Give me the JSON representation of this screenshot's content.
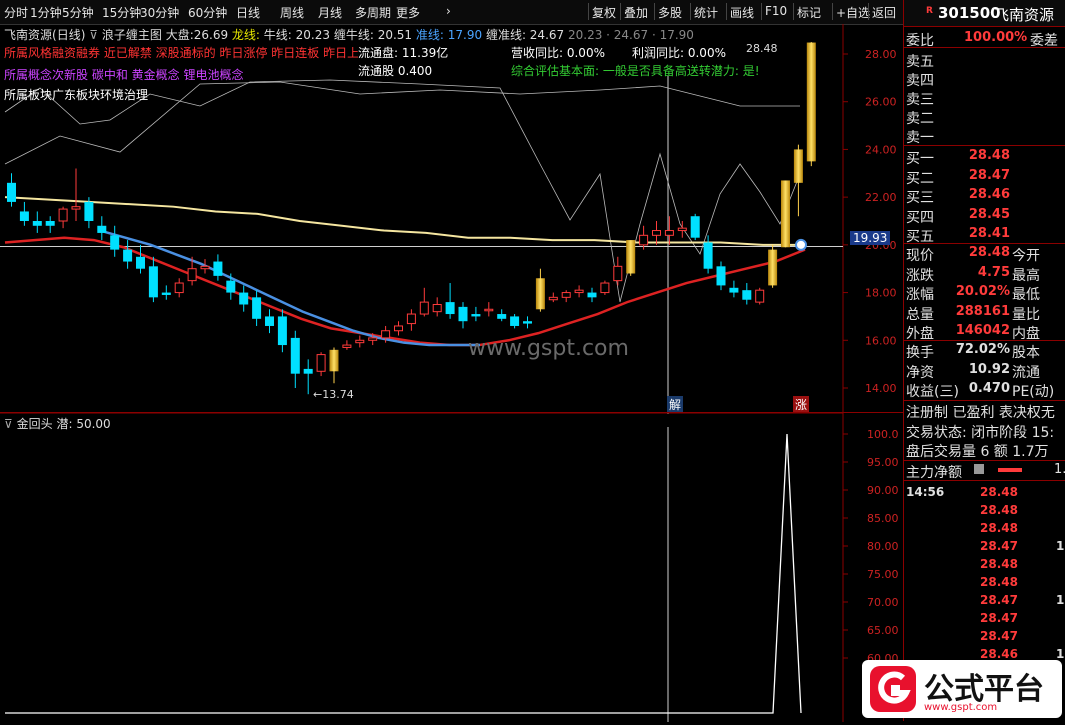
{
  "toolbar": {
    "left_items": [
      "分时",
      "1分钟",
      "5分钟",
      "15分钟",
      "30分钟",
      "60分钟",
      "日线",
      "周线",
      "月线",
      "多周期",
      "更多"
    ],
    "right_items": [
      "复权",
      "叠加",
      "多股",
      "统计",
      "画线",
      "F10",
      "标记",
      "+自选",
      "返回"
    ]
  },
  "header": {
    "stock": "飞南资源",
    "period": "(日线)",
    "indicator": "浪子缠主图",
    "dapan_label": "大盘:",
    "dapan_value": "26.69",
    "longxian_label": "龙线:",
    "niuxian": "牛线: 20.23",
    "channiu": "缠牛线: 20.51",
    "zhunxian": "准线: 17.90",
    "chanzhun": "缠准线: 24.67",
    "extra": "20.23 · 24.67 · 17.90",
    "risk_text": "所属风格融资融券 近已解禁 深股通标的 昨日涨停 昨日连板 昨日上榜",
    "circ_label": "流通盘: 11.39亿",
    "revenue_label": "营收同比: 0.00%",
    "profit_label": "利润同比: 0.00%",
    "concept_text": "所属概念次新股 碳中和 黄金概念 锂电池概念",
    "circ_shares": "流通股  0.400",
    "eval_text": "综合评估基本面: 一般是否具备高送转潜力: 是!",
    "board_text": "所属板块广东板块环境治理",
    "last_price_label": "28.48",
    "low_label": "←13.74",
    "cross_price": "19.93",
    "marker_jie": "解",
    "marker_zhang": "涨"
  },
  "sub": {
    "title": "金回头",
    "param": "潜: 50.00",
    "yticks": [
      "100.0",
      "95.00",
      "90.00",
      "85.00",
      "80.00",
      "75.00",
      "70.00",
      "65.00",
      "60.00"
    ]
  },
  "main_yticks": [
    "28.00",
    "26.00",
    "24.00",
    "22.00",
    "20.00",
    "18.00",
    "16.00",
    "14.00"
  ],
  "watermark": "www.gspt.com",
  "panel": {
    "badge": "R",
    "code": "301500",
    "name": "飞南资源",
    "weibi_label": "委比",
    "weibi_value": "100.00%",
    "weicha_label": "委差",
    "sells": [
      "卖五",
      "卖四",
      "卖三",
      "卖二",
      "卖一"
    ],
    "buys": [
      {
        "label": "买一",
        "price": "28.48"
      },
      {
        "label": "买二",
        "price": "28.47"
      },
      {
        "label": "买三",
        "price": "28.46"
      },
      {
        "label": "买四",
        "price": "28.45"
      },
      {
        "label": "买五",
        "price": "28.41"
      }
    ],
    "quotes": [
      {
        "label": "现价",
        "value": "28.48",
        "extra": "今开"
      },
      {
        "label": "涨跌",
        "value": "4.75",
        "extra": "最高"
      },
      {
        "label": "涨幅",
        "value": "20.02%",
        "extra": "最低"
      },
      {
        "label": "总量",
        "value": "288161",
        "extra": "量比"
      },
      {
        "label": "外盘",
        "value": "146042",
        "extra": "内盘"
      }
    ],
    "fundamentals": [
      {
        "label": "换手",
        "value": "72.02%",
        "extra": "股本"
      },
      {
        "label": "净资",
        "value": "10.92",
        "extra": "流通"
      },
      {
        "label": "收益(三)",
        "value": "0.470",
        "extra": "PE(动)"
      }
    ],
    "reg_text": "注册制 已盈利 表决权无",
    "trade_status": "交易状态: 闭市阶段 15:",
    "after_hours": "盘后交易量 6 额 1.7万",
    "main_net": "主力净额",
    "main_net_val": "1.",
    "ticks_time": "14:56",
    "ticks": [
      "28.48",
      "28.48",
      "28.48",
      "28.47",
      "28.48",
      "28.48",
      "28.47",
      "28.47",
      "28.47",
      "28.46"
    ],
    "tick_vols": [
      "",
      "",
      "",
      "1",
      "",
      "",
      "1",
      "",
      "",
      "1"
    ]
  },
  "logo": {
    "text": "公式平台",
    "sub": "www.gspt.com"
  },
  "chart_data": {
    "type": "candlestick",
    "ylim": [
      13,
      29
    ],
    "candles": [
      {
        "o": 22.6,
        "h": 23.0,
        "c": 21.8,
        "l": 21.6
      },
      {
        "o": 21.4,
        "h": 21.8,
        "c": 21.0,
        "l": 20.8
      },
      {
        "o": 21.0,
        "h": 21.4,
        "c": 20.8,
        "l": 20.5
      },
      {
        "o": 21.0,
        "h": 21.2,
        "c": 20.8,
        "l": 20.5
      },
      {
        "o": 21.0,
        "h": 21.6,
        "c": 21.5,
        "l": 20.7
      },
      {
        "o": 21.5,
        "h": 23.2,
        "c": 21.6,
        "l": 21.0
      },
      {
        "o": 21.8,
        "h": 22.0,
        "c": 21.0,
        "l": 20.7
      },
      {
        "o": 20.8,
        "h": 21.2,
        "c": 20.5,
        "l": 20.2
      },
      {
        "o": 20.4,
        "h": 20.8,
        "c": 19.8,
        "l": 19.5
      },
      {
        "o": 19.8,
        "h": 20.2,
        "c": 19.3,
        "l": 19.0
      },
      {
        "o": 19.5,
        "h": 20.0,
        "c": 19.0,
        "l": 18.8
      },
      {
        "o": 19.1,
        "h": 19.5,
        "c": 17.8,
        "l": 17.6
      },
      {
        "o": 18.0,
        "h": 18.3,
        "c": 17.9,
        "l": 17.7
      },
      {
        "o": 18.0,
        "h": 18.6,
        "c": 18.4,
        "l": 17.8
      },
      {
        "o": 18.5,
        "h": 19.5,
        "c": 19.0,
        "l": 18.3
      },
      {
        "o": 19.0,
        "h": 19.4,
        "c": 19.1,
        "l": 18.8
      },
      {
        "o": 19.3,
        "h": 19.6,
        "c": 18.7,
        "l": 18.5
      },
      {
        "o": 18.5,
        "h": 18.8,
        "c": 18.0,
        "l": 17.7
      },
      {
        "o": 18.0,
        "h": 18.3,
        "c": 17.5,
        "l": 17.2
      },
      {
        "o": 17.8,
        "h": 18.1,
        "c": 16.9,
        "l": 16.6
      },
      {
        "o": 17.0,
        "h": 17.3,
        "c": 16.6,
        "l": 16.3
      },
      {
        "o": 17.0,
        "h": 17.3,
        "c": 15.8,
        "l": 15.5
      },
      {
        "o": 16.1,
        "h": 16.4,
        "c": 14.6,
        "l": 14.0
      },
      {
        "o": 14.8,
        "h": 15.2,
        "c": 14.6,
        "l": 13.74
      },
      {
        "o": 14.7,
        "h": 15.5,
        "c": 15.4,
        "l": 14.5
      },
      {
        "o": 14.7,
        "h": 15.7,
        "c": 15.6,
        "l": 14.2
      },
      {
        "o": 15.7,
        "h": 16.0,
        "c": 15.8,
        "l": 15.6
      },
      {
        "o": 15.9,
        "h": 16.2,
        "c": 16.0,
        "l": 15.7
      },
      {
        "o": 16.0,
        "h": 16.3,
        "c": 16.1,
        "l": 15.8
      },
      {
        "o": 16.1,
        "h": 16.6,
        "c": 16.4,
        "l": 15.9
      },
      {
        "o": 16.4,
        "h": 16.8,
        "c": 16.6,
        "l": 16.2
      },
      {
        "o": 16.7,
        "h": 17.3,
        "c": 17.1,
        "l": 16.4
      },
      {
        "o": 17.1,
        "h": 18.2,
        "c": 17.6,
        "l": 17.0
      },
      {
        "o": 17.2,
        "h": 17.8,
        "c": 17.5,
        "l": 17.0
      },
      {
        "o": 17.6,
        "h": 18.4,
        "c": 17.1,
        "l": 16.9
      },
      {
        "o": 17.4,
        "h": 17.6,
        "c": 16.8,
        "l": 16.5
      },
      {
        "o": 17.1,
        "h": 17.4,
        "c": 17.0,
        "l": 16.8
      },
      {
        "o": 17.3,
        "h": 17.6,
        "c": 17.3,
        "l": 17.0
      },
      {
        "o": 17.1,
        "h": 17.3,
        "c": 16.9,
        "l": 16.8
      },
      {
        "o": 17.0,
        "h": 17.1,
        "c": 16.6,
        "l": 16.5
      },
      {
        "o": 16.8,
        "h": 17.0,
        "c": 16.7,
        "l": 16.5
      },
      {
        "o": 17.3,
        "h": 19.0,
        "c": 18.6,
        "l": 17.2
      },
      {
        "o": 17.7,
        "h": 18.0,
        "c": 17.8,
        "l": 17.6
      },
      {
        "o": 17.8,
        "h": 18.1,
        "c": 18.0,
        "l": 17.6
      },
      {
        "o": 18.0,
        "h": 18.3,
        "c": 18.1,
        "l": 17.8
      },
      {
        "o": 18.0,
        "h": 18.2,
        "c": 17.8,
        "l": 17.6
      },
      {
        "o": 18.0,
        "h": 18.5,
        "c": 18.4,
        "l": 17.9
      },
      {
        "o": 18.5,
        "h": 19.5,
        "c": 19.1,
        "l": 18.3
      },
      {
        "o": 18.8,
        "h": 20.0,
        "c": 20.2,
        "l": 18.7
      },
      {
        "o": 20.0,
        "h": 20.8,
        "c": 20.4,
        "l": 19.8
      },
      {
        "o": 20.4,
        "h": 21.0,
        "c": 20.6,
        "l": 20.0
      },
      {
        "o": 20.4,
        "h": 21.2,
        "c": 20.6,
        "l": 20.0
      },
      {
        "o": 20.6,
        "h": 21.0,
        "c": 20.7,
        "l": 20.3
      },
      {
        "o": 21.2,
        "h": 21.3,
        "c": 20.3,
        "l": 20.2
      },
      {
        "o": 20.1,
        "h": 20.4,
        "c": 19.0,
        "l": 18.8
      },
      {
        "o": 19.1,
        "h": 19.3,
        "c": 18.3,
        "l": 18.1
      },
      {
        "o": 18.2,
        "h": 18.5,
        "c": 18.0,
        "l": 17.8
      },
      {
        "o": 18.1,
        "h": 18.4,
        "c": 17.7,
        "l": 17.5
      },
      {
        "o": 17.6,
        "h": 18.2,
        "c": 18.1,
        "l": 17.5
      },
      {
        "o": 18.3,
        "h": 20.0,
        "c": 19.8,
        "l": 18.2
      },
      {
        "o": 19.9,
        "h": 22.7,
        "c": 22.7,
        "l": 19.9
      },
      {
        "o": 22.6,
        "h": 24.2,
        "c": 24.0,
        "l": 21.2
      },
      {
        "o": 23.5,
        "h": 28.5,
        "c": 28.48,
        "l": 23.3
      }
    ],
    "ma_blue": [
      20.6,
      20.3,
      20.0,
      19.6,
      19.2,
      18.7,
      18.2,
      17.7,
      17.2,
      16.8,
      16.4,
      16.1,
      15.9,
      15.8,
      15.8,
      15.8
    ],
    "ma_red": [
      20.1,
      20.2,
      20.3,
      20.2,
      19.9,
      19.4,
      18.9,
      18.4,
      17.9,
      17.4,
      16.9,
      16.5,
      16.3,
      16.1,
      15.9,
      15.8,
      15.8,
      16.0,
      16.3,
      16.7,
      17.1,
      17.6,
      18.0,
      18.4,
      18.7,
      19.0,
      19.3,
      19.8
    ],
    "ma_yellow": [
      22.0,
      21.9,
      21.8,
      21.7,
      21.6,
      21.4,
      21.3,
      21.0,
      20.8,
      20.6,
      20.5,
      20.3,
      20.3,
      20.2,
      20.2,
      20.1,
      20.1,
      20.1,
      20.0,
      20.0
    ],
    "sub_signal": {
      "x_index": 60,
      "peak": 100,
      "base": 50
    }
  }
}
